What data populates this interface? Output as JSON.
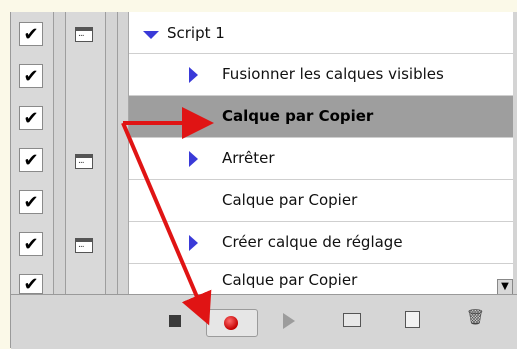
{
  "actions": {
    "set_name": "Script 1",
    "items": [
      {
        "label": "Fusionner les calques visibles"
      },
      {
        "label": "Calque par Copier"
      },
      {
        "label": "Arrêter"
      },
      {
        "label": "Calque par Copier"
      },
      {
        "label": "Créer calque de réglage"
      },
      {
        "label": "Calque par Copier"
      }
    ],
    "selected_item_index": 1
  },
  "toolbar": {
    "stop": "stop-icon",
    "record": "record-icon",
    "play": "play-icon",
    "new_set": "folder-icon",
    "new_action": "new-action-icon",
    "delete": "trash-icon"
  },
  "colors": {
    "arrow": "#e01414",
    "selected_row": "#9e9e9e",
    "expand_triangle": "#3a3ad8",
    "record_dot": "#c40000"
  }
}
